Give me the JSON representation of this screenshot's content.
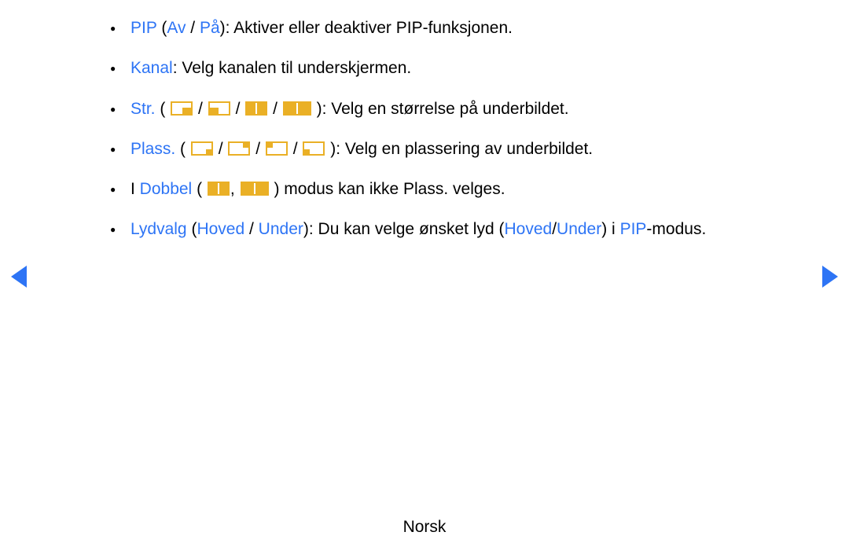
{
  "items": {
    "pip": {
      "label": "PIP",
      "opt1": "Av",
      "opt2": "På",
      "desc": ": Aktiver eller deaktiver PIP-funksjonen."
    },
    "kanal": {
      "label": "Kanal",
      "desc": ": Velg kanalen til underskjermen."
    },
    "str": {
      "label": "Str.",
      "desc": "): Velg en størrelse på underbildet."
    },
    "plass": {
      "label": "Plass.",
      "desc": "): Velg en plassering av underbildet."
    },
    "dobbel": {
      "pre": "I ",
      "label": "Dobbel",
      "desc": ") modus kan ikke Plass. velges."
    },
    "lydvalg": {
      "label": "Lydvalg",
      "opt1": "Hoved",
      "opt2": "Under",
      "mid": "): Du kan velge ønsket lyd (",
      "opt3": "Hoved",
      "opt4": "Under",
      "mid2": ") i ",
      "pip": "PIP",
      "tail": "-modus."
    }
  },
  "footer": "Norsk",
  "sep": " / "
}
